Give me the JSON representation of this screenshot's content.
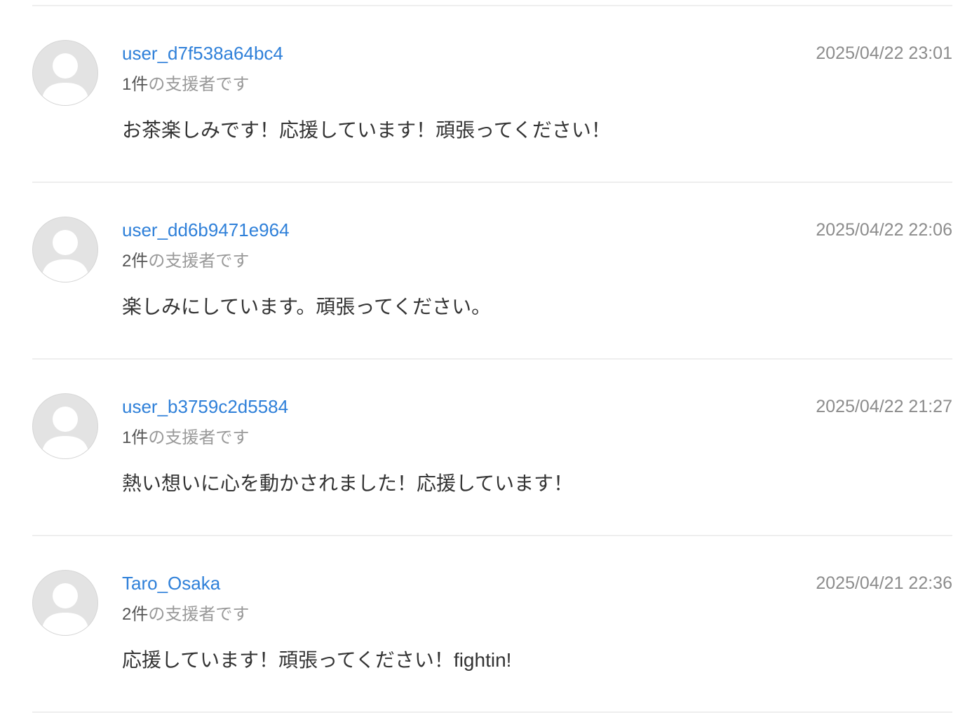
{
  "comments": [
    {
      "username": "user_d7f538a64bc4",
      "support_count": "1件",
      "support_suffix": "の支援者です",
      "timestamp": "2025/04/22 23:01",
      "message": "お茶楽しみです！応援しています！頑張ってください！"
    },
    {
      "username": "user_dd6b9471e964",
      "support_count": "2件",
      "support_suffix": "の支援者です",
      "timestamp": "2025/04/22 22:06",
      "message": "楽しみにしています。頑張ってください。"
    },
    {
      "username": "user_b3759c2d5584",
      "support_count": "1件",
      "support_suffix": "の支援者です",
      "timestamp": "2025/04/22 21:27",
      "message": "熱い想いに心を動かされました！応援しています！"
    },
    {
      "username": "Taro_Osaka",
      "support_count": "2件",
      "support_suffix": "の支援者です",
      "timestamp": "2025/04/21 22:36",
      "message": "応援しています！頑張ってください！fightin!"
    }
  ],
  "colors": {
    "username": "#2f80d9",
    "timestamp": "#8c8c8c",
    "message": "#333333",
    "avatar": "#e3e3e3",
    "divider": "#eeeeee"
  },
  "icons": {
    "avatar": "default-user-avatar-icon"
  }
}
